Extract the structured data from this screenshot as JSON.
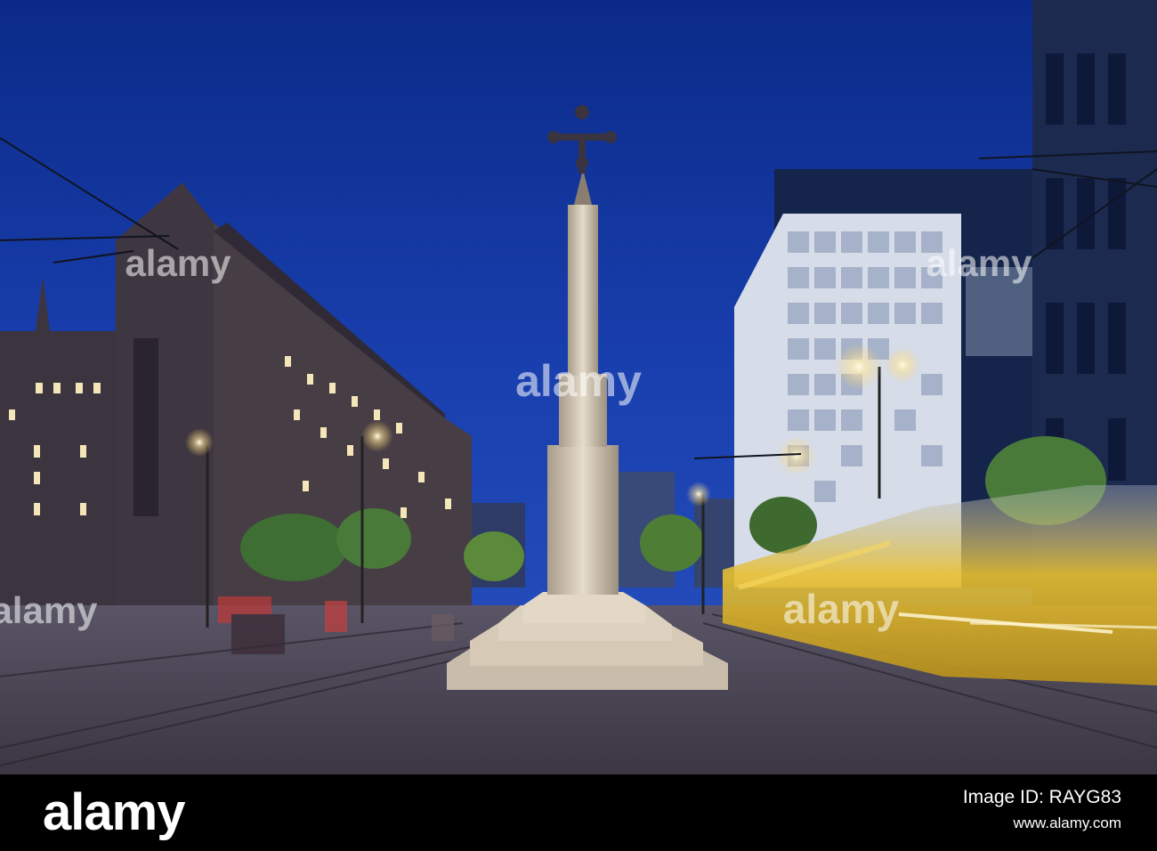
{
  "watermark": {
    "text": "alamy"
  },
  "footer": {
    "logo": "alamy",
    "image_id": "Image ID: RAYG83",
    "url": "www.alamy.com"
  },
  "colors": {
    "sky": "#1638a0",
    "pavement": "#4a4450",
    "monument": "#d8cdbd",
    "tram": "#e0b21a",
    "street_light": "#fff6d8"
  }
}
